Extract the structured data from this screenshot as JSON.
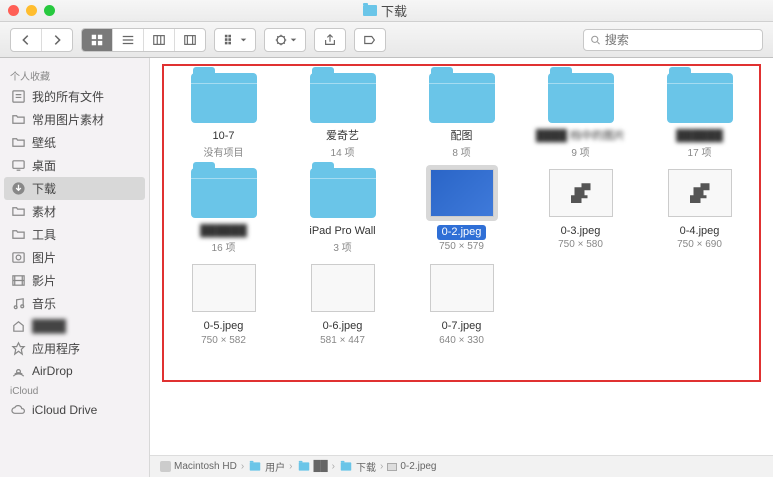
{
  "window": {
    "title": "下载"
  },
  "search": {
    "placeholder": "搜索"
  },
  "sidebar": {
    "section1": "个人收藏",
    "items": [
      {
        "label": "我的所有文件",
        "icon": "all-files"
      },
      {
        "label": "常用图片素材",
        "icon": "folder"
      },
      {
        "label": "壁纸",
        "icon": "folder"
      },
      {
        "label": "桌面",
        "icon": "desktop"
      },
      {
        "label": "下载",
        "icon": "downloads",
        "active": true
      },
      {
        "label": "素材",
        "icon": "folder"
      },
      {
        "label": "工具",
        "icon": "folder"
      },
      {
        "label": "图片",
        "icon": "pictures"
      },
      {
        "label": "影片",
        "icon": "movies"
      },
      {
        "label": "音乐",
        "icon": "music"
      },
      {
        "label": "████",
        "icon": "home",
        "blur": true
      },
      {
        "label": "应用程序",
        "icon": "apps"
      },
      {
        "label": "AirDrop",
        "icon": "airdrop"
      }
    ],
    "section2": "iCloud",
    "icloud_item": "iCloud Drive"
  },
  "files": [
    {
      "name": "10-7",
      "sub": "没有项目",
      "kind": "folder"
    },
    {
      "name": "爱奇艺",
      "sub": "14 项",
      "kind": "folder"
    },
    {
      "name": "配图",
      "sub": "8 项",
      "kind": "folder"
    },
    {
      "name": "████ 档中的图片",
      "sub": "9 项",
      "kind": "folder",
      "blur": true
    },
    {
      "name": "██████",
      "sub": "17 项",
      "kind": "folder",
      "blur": true
    },
    {
      "name": "██████",
      "sub": "16 项",
      "kind": "folder",
      "blur": true
    },
    {
      "name": "iPad Pro Wall",
      "sub": "3 项",
      "kind": "folder"
    },
    {
      "name": "0-2.jpeg",
      "sub": "750 × 579",
      "kind": "apps",
      "selected": true
    },
    {
      "name": "0-3.jpeg",
      "sub": "750 × 580",
      "kind": "dino"
    },
    {
      "name": "0-4.jpeg",
      "sub": "750 × 690",
      "kind": "dino"
    },
    {
      "name": "0-5.jpeg",
      "sub": "750 × 582",
      "kind": "img"
    },
    {
      "name": "0-6.jpeg",
      "sub": "581 × 447",
      "kind": "img"
    },
    {
      "name": "0-7.jpeg",
      "sub": "640 × 330",
      "kind": "img"
    }
  ],
  "path": [
    "Macintosh HD",
    "用户",
    "██",
    "下载",
    "0-2.jpeg"
  ]
}
